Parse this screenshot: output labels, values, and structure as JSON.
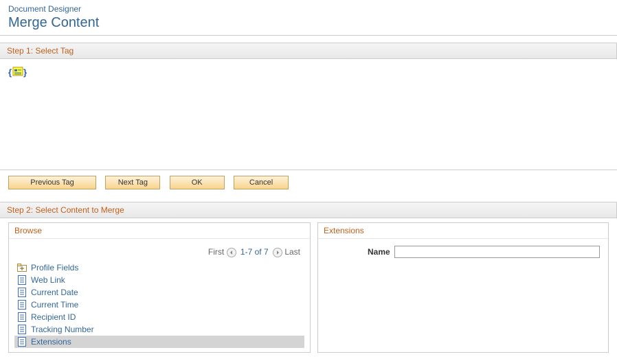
{
  "breadcrumb": {
    "label": "Document Designer"
  },
  "page_title": "Merge Content",
  "step1": {
    "title": "Step 1: Select Tag"
  },
  "buttons": {
    "prev": "Previous Tag",
    "next": "Next Tag",
    "ok": "OK",
    "cancel": "Cancel"
  },
  "step2": {
    "title": "Step 2: Select Content to Merge"
  },
  "browse": {
    "title": "Browse",
    "pager": {
      "first": "First",
      "range": "1-7 of 7",
      "last": "Last"
    },
    "items": [
      {
        "label": "Profile Fields",
        "type": "folder",
        "selected": false
      },
      {
        "label": "Web Link",
        "type": "doc",
        "selected": false
      },
      {
        "label": "Current Date",
        "type": "doc",
        "selected": false
      },
      {
        "label": "Current Time",
        "type": "doc",
        "selected": false
      },
      {
        "label": "Recipient ID",
        "type": "doc",
        "selected": false
      },
      {
        "label": "Tracking Number",
        "type": "doc",
        "selected": false
      },
      {
        "label": "Extensions",
        "type": "doc",
        "selected": true
      }
    ]
  },
  "extensions": {
    "title": "Extensions",
    "nameLabel": "Name",
    "nameValue": ""
  }
}
